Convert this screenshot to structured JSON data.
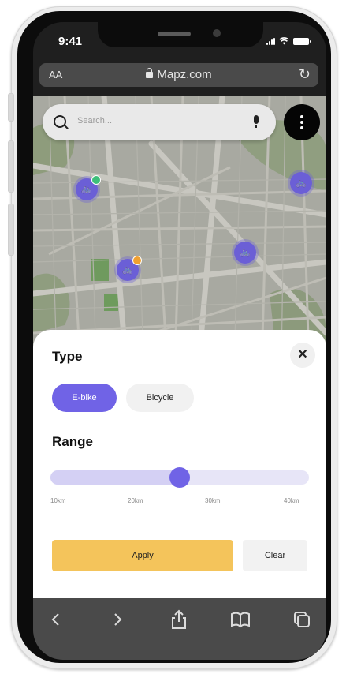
{
  "status": {
    "time": "9:41"
  },
  "browser": {
    "font_size_label": "AA",
    "url": "Mapz.com"
  },
  "search": {
    "placeholder": "Search..."
  },
  "map": {
    "pins": [
      {
        "name": "bike-pin-1",
        "badge": "green",
        "badge_color": "#3dbf7a"
      },
      {
        "name": "bike-pin-2",
        "badge": "none"
      },
      {
        "name": "bike-pin-3",
        "badge": "none"
      },
      {
        "name": "bike-pin-4",
        "badge": "orange",
        "badge_color": "#f0a030"
      }
    ]
  },
  "filters": {
    "type_title": "Type",
    "close_label": "✕",
    "types": [
      {
        "label": "E-bike",
        "selected": true
      },
      {
        "label": "Bicycle",
        "selected": false
      }
    ],
    "range_title": "Range",
    "range_ticks": [
      "10km",
      "20km",
      "30km",
      "40km"
    ],
    "range_value_fraction": 0.5,
    "apply_label": "Apply",
    "clear_label": "Clear"
  },
  "colors": {
    "accent": "#7063e6",
    "apply": "#f4c45b",
    "map": "#a6a69e"
  },
  "toolbar": {
    "icons": [
      "back-icon",
      "forward-icon",
      "share-icon",
      "bookmarks-icon",
      "tabs-icon"
    ]
  }
}
